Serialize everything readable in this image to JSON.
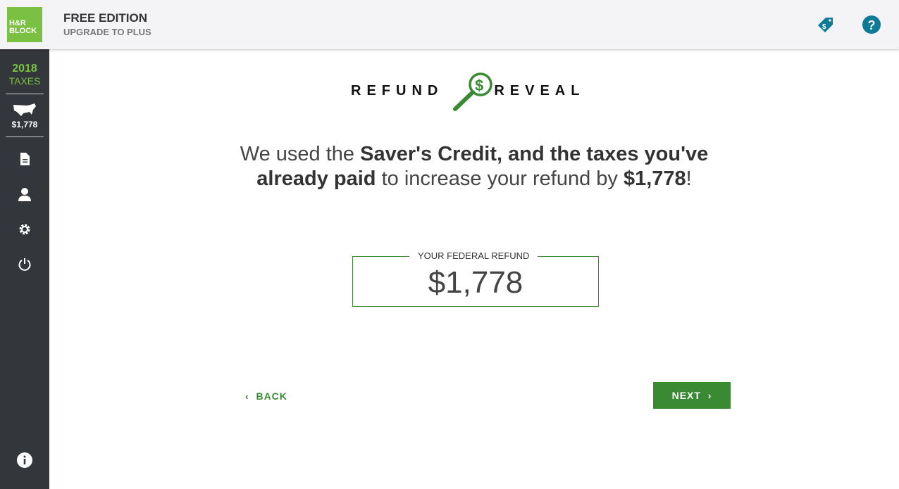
{
  "header": {
    "logo": "H&R BLOCK",
    "edition": "FREE EDITION",
    "upgrade": "UPGRADE TO PLUS"
  },
  "sidebar": {
    "year": "2018",
    "taxes": "TAXES",
    "refund": "$1,778"
  },
  "main": {
    "brand_left": "REFUND",
    "brand_right": "REVEAL",
    "msg": {
      "p1": "We used the ",
      "b1": "Saver's Credit, and the taxes you've already paid",
      "p2": " to increase your refund by ",
      "b2": "$1,778",
      "p3": "!"
    },
    "refund_label": "YOUR FEDERAL REFUND",
    "refund_value": "$1,778",
    "back": "BACK",
    "next": "NEXT"
  },
  "colors": {
    "green": "#3a8a33",
    "logo_green": "#7ac143",
    "teal": "#0e7a96",
    "sidebar": "#33363b"
  }
}
